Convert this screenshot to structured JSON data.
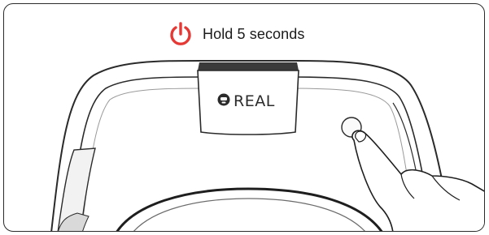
{
  "instruction": {
    "text": "Hold 5 seconds",
    "icon": "power-icon",
    "icon_color": "#e53935"
  },
  "device": {
    "brand_label": "REAL",
    "logo_icon": "brand-logo-icon",
    "button_icon": "power-button-icon"
  },
  "colors": {
    "outline": "#2a2a2a",
    "accent": "#e53935"
  }
}
